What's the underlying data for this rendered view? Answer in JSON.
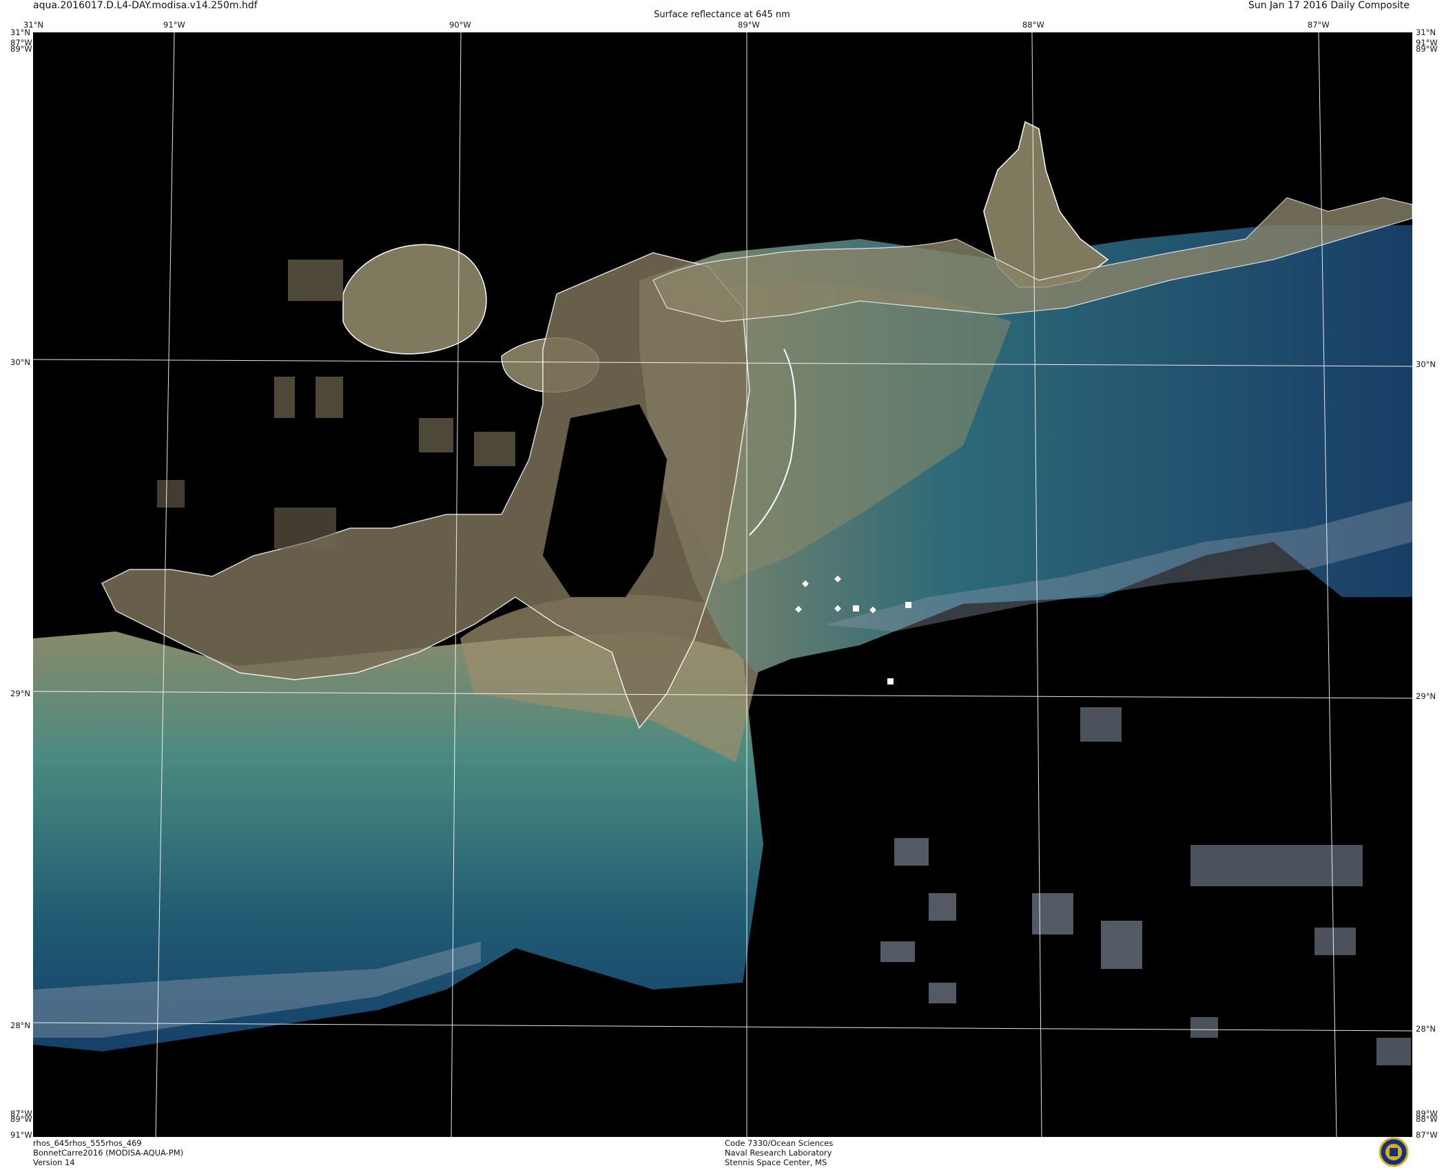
{
  "header": {
    "file_name": "aqua.2016017.D.L4-DAY.modisa.v14.250m.hdf",
    "product_title": "Surface reflectance at 645 nm",
    "composite_date": "Sun Jan 17 2016 Daily Composite"
  },
  "map": {
    "longitude_labels_top": [
      "91°W",
      "90°W",
      "89°W",
      "88°W",
      "87°W"
    ],
    "latitude_labels_left": [
      "31°N",
      "30°N",
      "29°N",
      "28°N"
    ],
    "latitude_labels_right": [
      "31°N",
      "30°N",
      "29°N",
      "28°N"
    ],
    "corner_labels": {
      "top_left_lat": "31°N",
      "top_left_lon": "89°W",
      "top_left_lon_overlap": "87°W",
      "top_right_lat": "31°N",
      "top_right_lon": "89°W",
      "top_right_lon_overlap": "91°W",
      "bottom_left_lon": "91°W",
      "bottom_left_overlap": "89°W",
      "bottom_left_overlap_2": "87°W",
      "bottom_right_lon": "87°W",
      "bottom_right_overlap": "88°W",
      "bottom_right_overlap_2": "89°W"
    },
    "colors": {
      "deep_water": "#0d2a52",
      "mid_water": "#1f5a6e",
      "shelf_water": "#3f8a8a",
      "turbid_plume": "#9a8c6c",
      "land_fill": "#7a7058",
      "no_data": "#000000",
      "grid": "#ffffff",
      "cloud": "#8a96a8"
    }
  },
  "footer": {
    "left_lines": [
      "rhos_645rhos_555rhos_469",
      "BonnetCarre2016 (MODISA-AQUA-PM)",
      "Version 14"
    ],
    "center_lines": [
      "Code 7330/Ocean Sciences",
      "Naval Research Laboratory",
      "Stennis Space Center, MS"
    ],
    "logo_icon": "navy-seal-icon"
  }
}
